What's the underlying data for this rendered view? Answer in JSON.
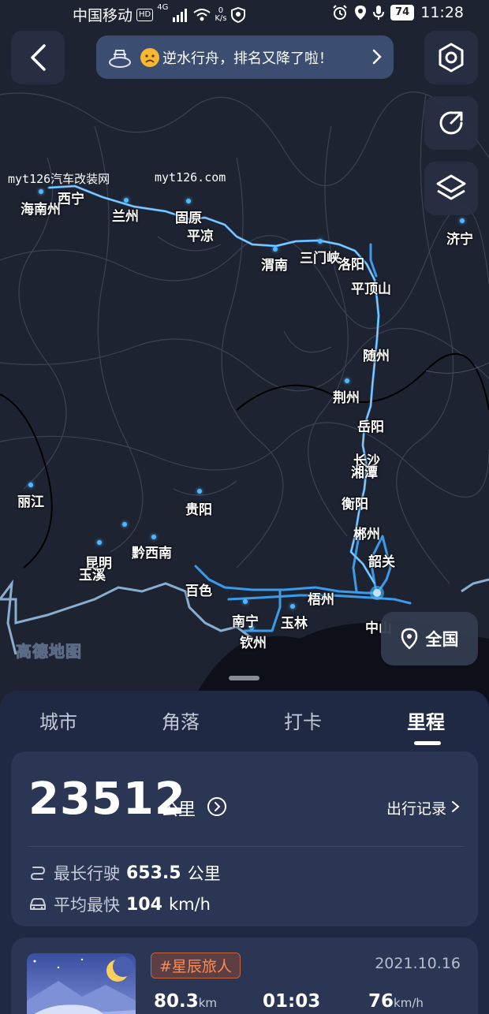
{
  "status_bar": {
    "carrier": "中国移动",
    "hd": "HD",
    "network": "4G",
    "speed_value": "0",
    "speed_unit": "K/s",
    "battery": "74",
    "time": "11:28"
  },
  "banner": {
    "text": "逆水行舟，排名又降了啦！"
  },
  "watermark": {
    "left": "myt126汽车改装网",
    "right": "myt126.com"
  },
  "map": {
    "logo": "高德地图",
    "locate_label": "全国",
    "cities": [
      "西宁",
      "海南州",
      "兰州",
      "固原",
      "平凉",
      "济宁",
      "渭南",
      "三门峡",
      "洛阳",
      "平顶山",
      "随州",
      "荆州",
      "岳阳",
      "长沙",
      "湘潭",
      "衡阳",
      "丽江",
      "贵阳",
      "郴州",
      "黔西南",
      "昆明",
      "玉溪",
      "韶关",
      "百色",
      "梧州",
      "南宁",
      "玉林",
      "钦州",
      "中山"
    ]
  },
  "tabs": [
    "城市",
    "角落",
    "打卡",
    "里程"
  ],
  "active_tab": "里程",
  "summary": {
    "total_distance": "23512",
    "total_unit": "公里",
    "trip_record_label": "出行记录",
    "longest_label": "最长行驶",
    "longest_value": "653.5",
    "longest_unit": "公里",
    "fastest_label": "平均最快",
    "fastest_value": "104",
    "fastest_unit": "km/h"
  },
  "record": {
    "tag": "#星辰旅人",
    "date": "2021.10.16",
    "distance": "80.3",
    "distance_unit": "km",
    "duration": "01:03",
    "speed": "76",
    "speed_unit": "km/h"
  },
  "colors": {
    "route": "#4fb8ff",
    "sheet_bg": "#1f2944",
    "card_bg": "#2b3654",
    "tag": "#ff8a50"
  }
}
